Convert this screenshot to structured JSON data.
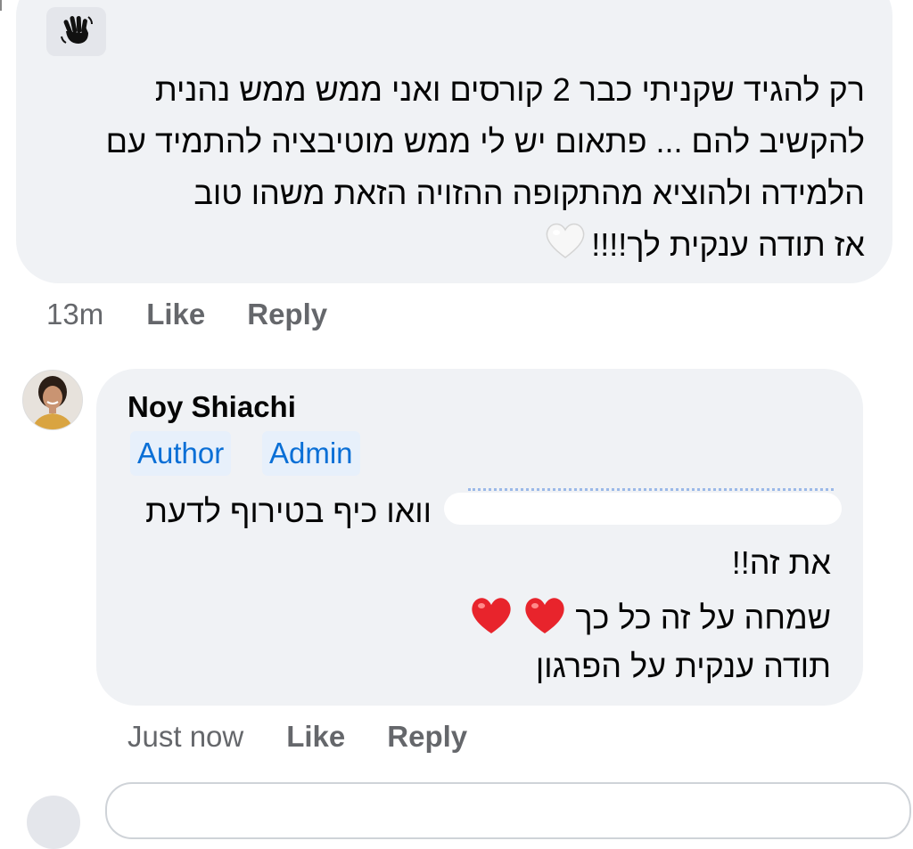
{
  "comment1": {
    "lines": [
      "רק להגיד שקניתי כבר 2 קורסים ואני ממש ממש נהנית",
      "להקשיב להם ... פתאום יש לי ממש מוטיבציה להתמיד עם",
      "הלמידה ולהוציא מהתקופה ההזויה הזאת משהו טוב",
      "אז תודה ענקית לך!!!!"
    ],
    "time": "13m",
    "like_label": "Like",
    "reply_label": "Reply"
  },
  "reply": {
    "author_name": "Noy Shiachi",
    "badges": [
      "Author",
      "Admin"
    ],
    "lines": [
      "וואו כיף בטירוף לדעת",
      "את זה!!",
      "שמחה על זה כל כך",
      "תודה ענקית על הפרגון"
    ],
    "time": "Just now",
    "like_label": "Like",
    "reply_label": "Reply"
  },
  "icons": {
    "wave": "waving-hand-icon",
    "white_heart": "white-heart-icon",
    "red_heart": "red-heart-icon"
  },
  "colors": {
    "bubble": "#f0f2f5",
    "badge_bg": "#e7f0fb",
    "badge_text": "#0a6fd6",
    "meta_text": "#65676b"
  }
}
